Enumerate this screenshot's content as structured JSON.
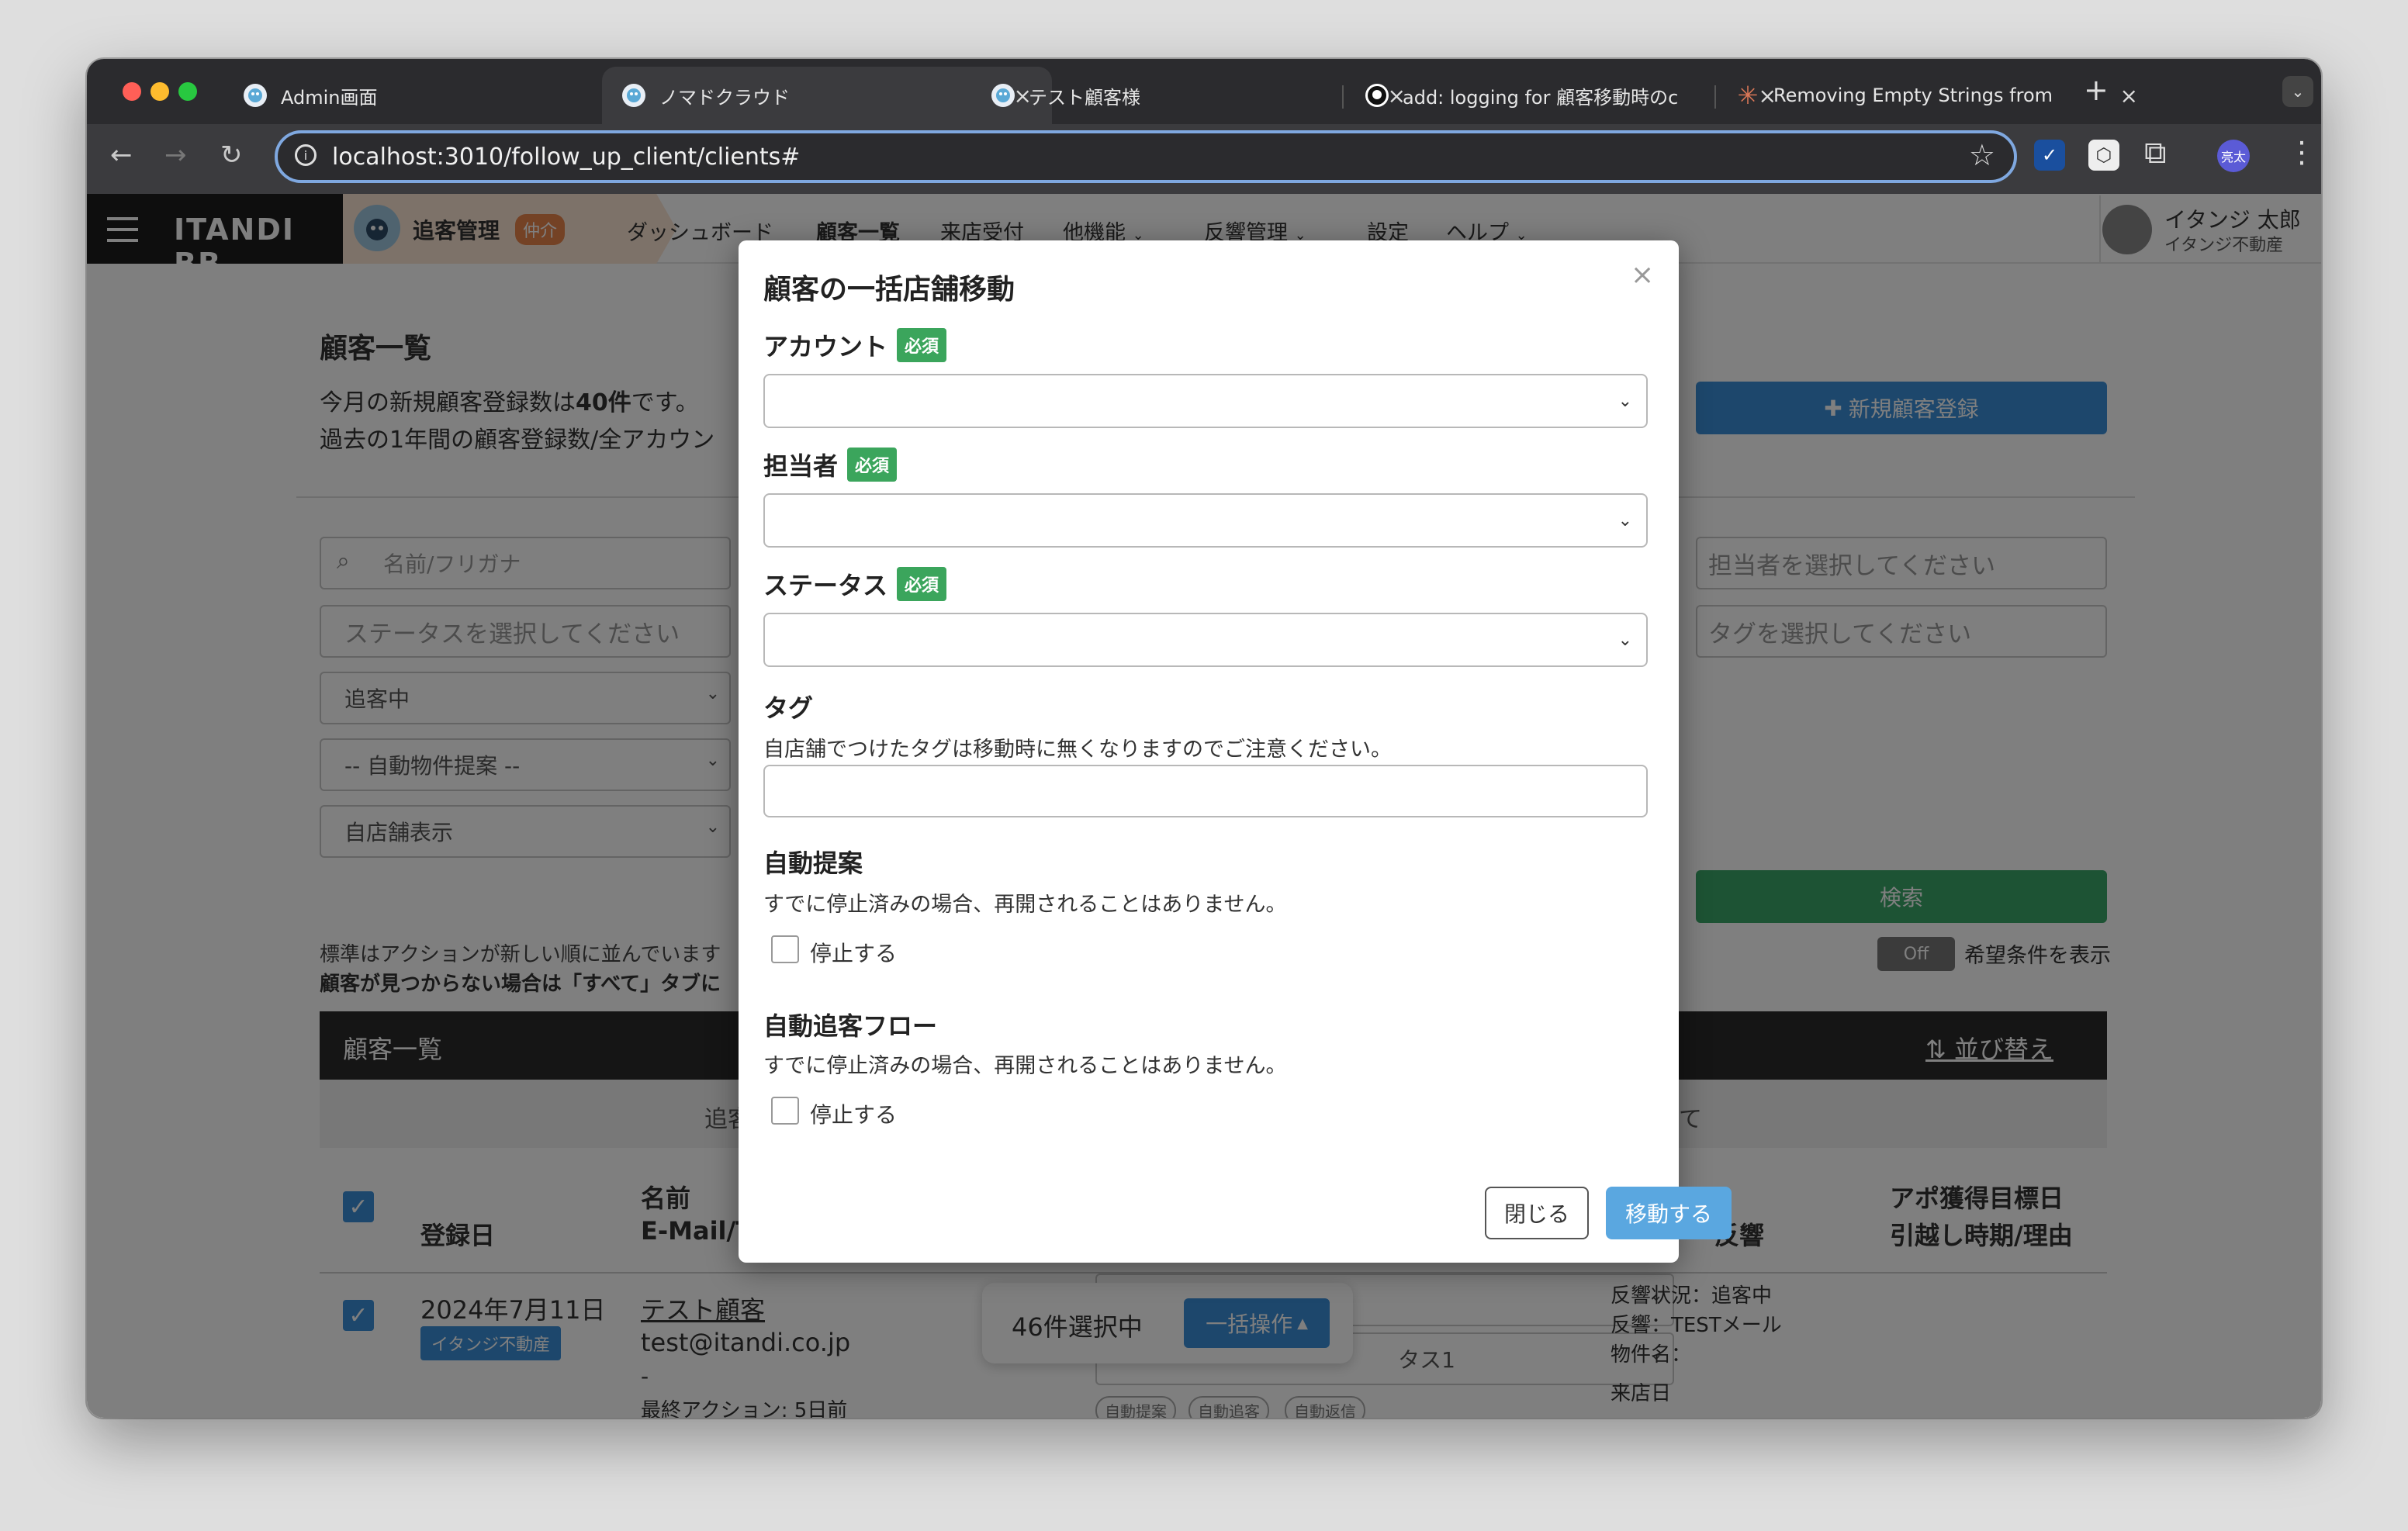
{
  "browser": {
    "tabs": [
      {
        "title": "Admin画面",
        "close": "×"
      },
      {
        "title": "ノマドクラウド",
        "close": "×"
      },
      {
        "title": "テスト顧客様",
        "close": "×"
      },
      {
        "title": "add: logging for 顧客移動時のc",
        "close": "×"
      },
      {
        "title": "Removing Empty Strings from",
        "close": "×"
      }
    ],
    "new_tab": "+",
    "url": "localhost:3010/follow_up_client/clients#",
    "profile": "亮太"
  },
  "app": {
    "brand": "ITANDI BB",
    "product": "追客管理",
    "product_badge": "仲介",
    "menu": [
      "ダッシュボード",
      "顧客一覧",
      "来店受付",
      "他機能",
      "反響管理",
      "設定",
      "ヘルプ"
    ],
    "user_name": "イタンジ 太郎",
    "user_company": "イタンジ不動産"
  },
  "page": {
    "title": "顧客一覧",
    "line1_prefix": "今月の新規顧客登録数は",
    "line1_count": "40件",
    "line1_suffix": "です。",
    "line2": "過去の1年間の顧客登録数/全アカウン",
    "new_client_button": "新規顧客登録",
    "search_placeholder": "名前/フリガナ",
    "status_placeholder": "ステータスを選択してください",
    "staff_placeholder": "担当者を選択してください",
    "tag_placeholder": "タグを選択してください",
    "filter_status": "追客中",
    "filter_auto": "-- 自動物件提案 --",
    "filter_store": "自店舗表示",
    "search_button": "検索",
    "toggle_off": "Off",
    "toggle_label": "希望条件を表示",
    "hint1": "標準はアクションが新しい順に並んでいます",
    "hint2": "顧客が見つからない場合は「すべて」タブに",
    "list_title": "顧客一覧",
    "sort_link": "並び替え",
    "tab_partial": "追客",
    "tab_partial2": "て",
    "col_date": "登録日",
    "col_name": "名前",
    "col_email": "E-Mail/T",
    "col_response": "反響",
    "col_target1": "アポ獲得目標日",
    "col_target2": "引越し時期/理由",
    "row_date": "2024年7月11日",
    "row_company": "イタンジ不動産",
    "row_name": "テスト顧客",
    "row_email": "test@itandi.co.jp",
    "row_dash": "-",
    "row_last_action": "最終アクション: 5日前",
    "row_resp1": "反響状況：追客中",
    "row_resp2": "反響：TESTメール",
    "row_resp3": "物件名：",
    "row_resp4": "来店日",
    "row_status_partial": "タス1",
    "row_chip1": "自動提案",
    "row_chip2": "自動追客",
    "row_chip3": "自動返信",
    "selection_count": "46件選択中",
    "bulk_button": "一括操作"
  },
  "modal": {
    "title": "顧客の一括店舗移動",
    "close": "×",
    "required": "必須",
    "account_label": "アカウント",
    "staff_label": "担当者",
    "status_label": "ステータス",
    "tag_label": "タグ",
    "tag_note": "自店舗でつけたタグは移動時に無くなりますのでご注意ください。",
    "auto_suggest_label": "自動提案",
    "auto_suggest_note": "すでに停止済みの場合、再開されることはありません。",
    "auto_suggest_checkbox": "停止する",
    "auto_flow_label": "自動追客フロー",
    "auto_flow_note": "すでに停止済みの場合、再開されることはありません。",
    "auto_flow_checkbox": "停止する",
    "close_button": "閉じる",
    "move_button": "移動する"
  },
  "colors": {
    "accent": "#3a8fd8",
    "required": "#3ba55c",
    "badge": "#e8844a",
    "dark_header": "#2a2a2a"
  }
}
